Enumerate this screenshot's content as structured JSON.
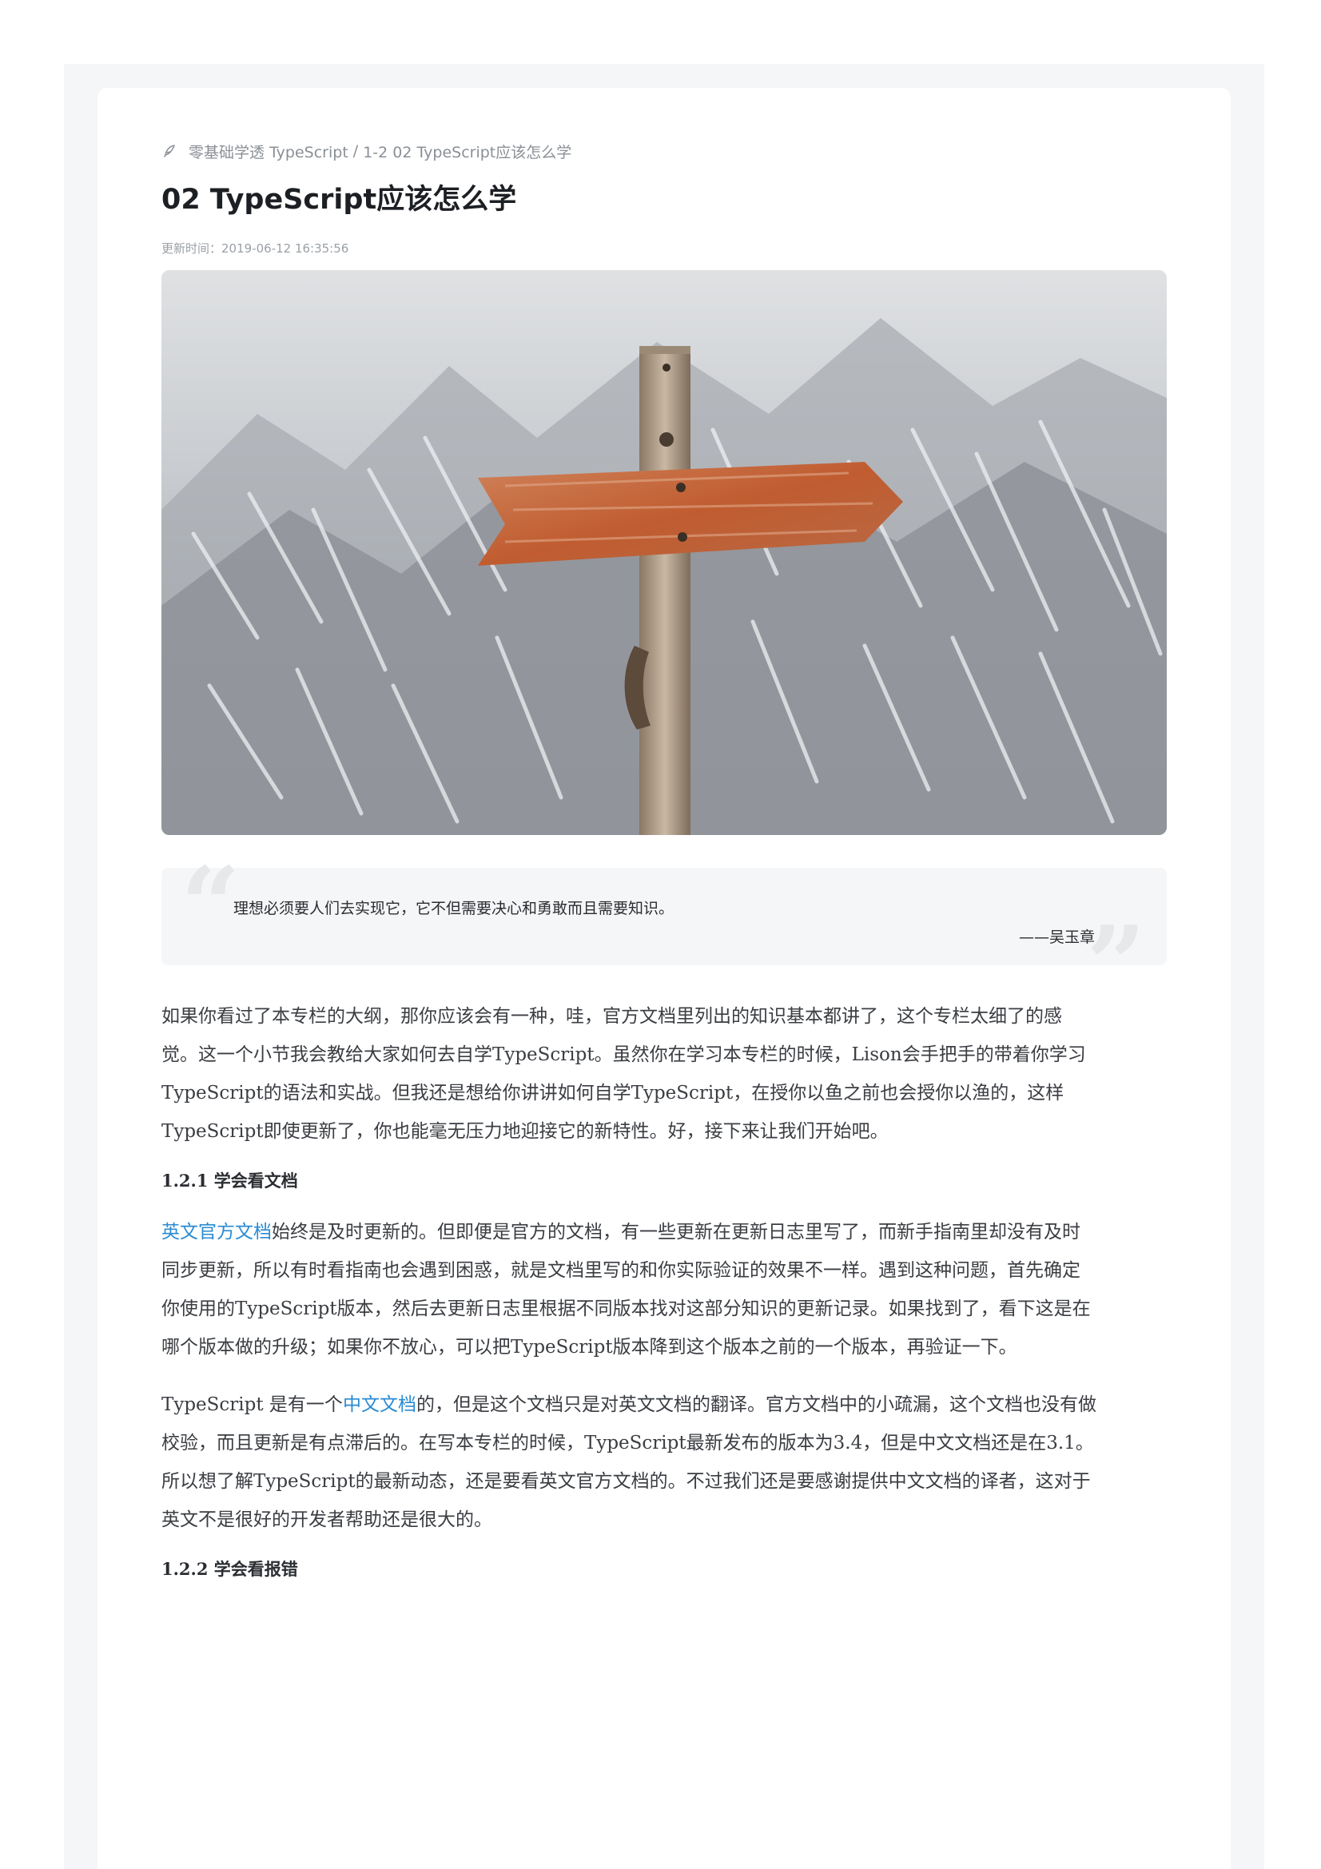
{
  "breadcrumb": {
    "icon": "feather-pen-icon",
    "course": "零基础学透 TypeScript",
    "separator": "/",
    "section": "1-2 02 TypeScript应该怎么学"
  },
  "article": {
    "title": "02 TypeScript应该怎么学",
    "updated_label": "更新时间：",
    "updated_value": "2019-06-12 16:35:56"
  },
  "hero_image": {
    "description_icon": "wooden-signpost-arrow-snowy-mountain"
  },
  "quote": {
    "text": "理想必须要人们去实现它，它不但需要决心和勇敢而且需要知识。",
    "author": "——吴玉章"
  },
  "intro": {
    "lines": [
      "如果你看过了本专栏的大纲，那你应该会有一种，哇，官方文档里列出的知识基本都讲了，这个专栏太细了的感",
      "觉。这一个小节我会教给大家如何去自学TypeScript。虽然你在学习本专栏的时候，Lison会手把手的带着你学习",
      "TypeScript的语法和实战。但我还是想给你讲讲如何自学TypeScript，在授你以鱼之前也会授你以渔的，这样",
      "TypeScript即使更新了，你也能毫无压力地迎接它的新特性。好，接下来让我们开始吧。"
    ]
  },
  "section_121": {
    "number": "1.2.1",
    "title": "学会看文档",
    "p1": {
      "link": "英文官方文档",
      "line1_rest": "始终是及时更新的。但即便是官方的文档，有一些更新在更新日志里写了，而新手指南里却没有及时",
      "lines": [
        "同步更新，所以有时看指南也会遇到困惑，就是文档里写的和你实际验证的效果不一样。遇到这种问题，首先确定",
        "你使用的TypeScript版本，然后去更新日志里根据不同版本找对这部分知识的更新记录。如果找到了，看下这是在",
        "哪个版本做的升级；如果你不放心，可以把TypeScript版本降到这个版本之前的一个版本，再验证一下。"
      ]
    },
    "p2": {
      "prefix": "TypeScript  是有一个",
      "link": "中文文档",
      "line1_rest": "的，但是这个文档只是对英文文档的翻译。官方文档中的小疏漏，这个文档也没有做",
      "lines": [
        "校验，而且更新是有点滞后的。在写本专栏的时候，TypeScript最新发布的版本为3.4，但是中文文档还是在3.1。",
        "所以想了解TypeScript的最新动态，还是要看英文官方文档的。不过我们还是要感谢提供中文文档的译者，这对于",
        "英文不是很好的开发者帮助还是很大的。"
      ]
    }
  },
  "section_122": {
    "number": "1.2.2",
    "title": "学会看报错"
  },
  "colors": {
    "link": "#2a8bd3",
    "page_bg": "#f5f6f7",
    "card_bg": "#ffffff",
    "sign_orange": "#c8643a"
  }
}
